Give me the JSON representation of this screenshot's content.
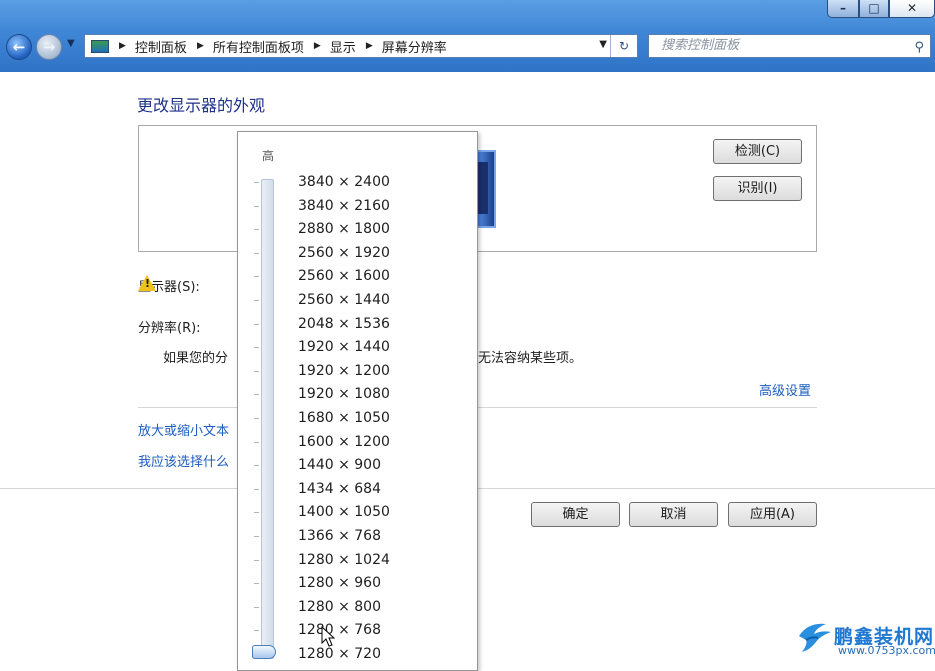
{
  "window": {
    "minimize_icon": "minimize-icon",
    "maximize_icon": "maximize-icon",
    "close_icon": "close-icon"
  },
  "address": {
    "breadcrumbs": [
      "控制面板",
      "所有控制面板项",
      "显示",
      "屏幕分辨率"
    ]
  },
  "search": {
    "placeholder": "搜索控制面板"
  },
  "content": {
    "heading": "更改显示器的外观",
    "detect_button": "检测(C)",
    "identify_button": "识别(I)",
    "display_label": "显示器(S):",
    "resolution_label": "分辨率(R):",
    "warning_left": "如果您的分",
    "warning_right": "无法容纳某些项。",
    "advanced_link": "高级设置",
    "link_text_size": "放大或缩小文本",
    "link_which_setting": "我应该选择什么",
    "ok_button": "确定",
    "cancel_button": "取消",
    "apply_button": "应用(A)"
  },
  "dropdown": {
    "high_label": "高",
    "resolutions": [
      "3840 × 2400",
      "3840 × 2160",
      "2880 × 1800",
      "2560 × 1920",
      "2560 × 1600",
      "2560 × 1440",
      "2048 × 1536",
      "1920 × 1440",
      "1920 × 1200",
      "1920 × 1080",
      "1680 × 1050",
      "1600 × 1200",
      "1440 × 900",
      "1434 × 684",
      "1400 × 1050",
      "1366 × 768",
      "1280 × 1024",
      "1280 × 960",
      "1280 × 800",
      "1280 × 768",
      "1280 × 720"
    ],
    "selected": "1280 × 720"
  },
  "watermark": {
    "name": "鹏鑫装机网",
    "url": "www.0753px.com"
  }
}
